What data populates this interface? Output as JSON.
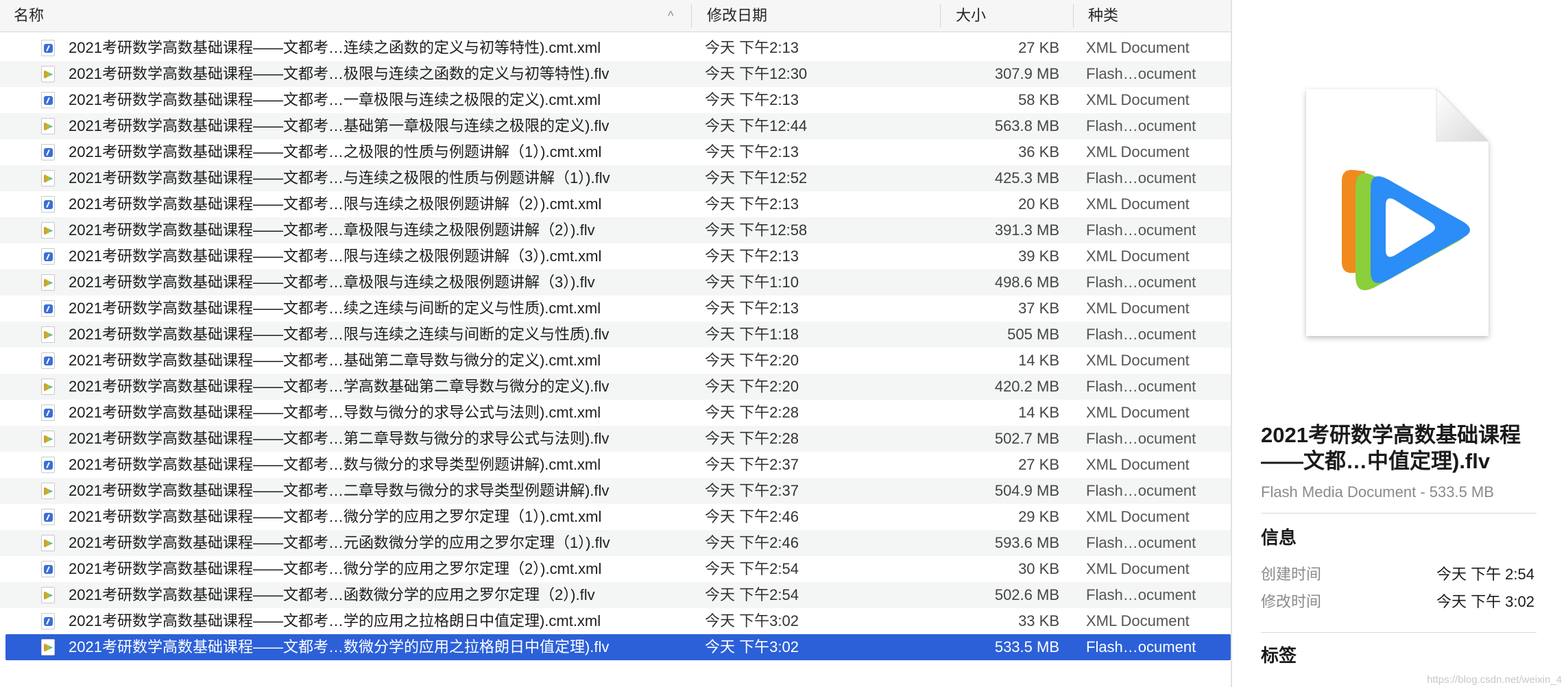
{
  "columns": {
    "name": "名称",
    "date": "修改日期",
    "size": "大小",
    "kind": "种类"
  },
  "files": [
    {
      "name": "2021考研数学高数基础课程——文都考…连续之函数的定义与初等特性).cmt.xml",
      "date": "今天 下午2:13",
      "size": "27 KB",
      "kind": "XML Document",
      "type": "xml"
    },
    {
      "name": "2021考研数学高数基础课程——文都考…极限与连续之函数的定义与初等特性).flv",
      "date": "今天 下午12:30",
      "size": "307.9 MB",
      "kind": "Flash…ocument",
      "type": "flv"
    },
    {
      "name": "2021考研数学高数基础课程——文都考…一章极限与连续之极限的定义).cmt.xml",
      "date": "今天 下午2:13",
      "size": "58 KB",
      "kind": "XML Document",
      "type": "xml"
    },
    {
      "name": "2021考研数学高数基础课程——文都考…基础第一章极限与连续之极限的定义).flv",
      "date": "今天 下午12:44",
      "size": "563.8 MB",
      "kind": "Flash…ocument",
      "type": "flv"
    },
    {
      "name": "2021考研数学高数基础课程——文都考…之极限的性质与例题讲解（1）).cmt.xml",
      "date": "今天 下午2:13",
      "size": "36 KB",
      "kind": "XML Document",
      "type": "xml"
    },
    {
      "name": "2021考研数学高数基础课程——文都考…与连续之极限的性质与例题讲解（1）).flv",
      "date": "今天 下午12:52",
      "size": "425.3 MB",
      "kind": "Flash…ocument",
      "type": "flv"
    },
    {
      "name": "2021考研数学高数基础课程——文都考…限与连续之极限例题讲解（2）).cmt.xml",
      "date": "今天 下午2:13",
      "size": "20 KB",
      "kind": "XML Document",
      "type": "xml"
    },
    {
      "name": "2021考研数学高数基础课程——文都考…章极限与连续之极限例题讲解（2）).flv",
      "date": "今天 下午12:58",
      "size": "391.3 MB",
      "kind": "Flash…ocument",
      "type": "flv"
    },
    {
      "name": "2021考研数学高数基础课程——文都考…限与连续之极限例题讲解（3）).cmt.xml",
      "date": "今天 下午2:13",
      "size": "39 KB",
      "kind": "XML Document",
      "type": "xml"
    },
    {
      "name": "2021考研数学高数基础课程——文都考…章极限与连续之极限例题讲解（3）).flv",
      "date": "今天 下午1:10",
      "size": "498.6 MB",
      "kind": "Flash…ocument",
      "type": "flv"
    },
    {
      "name": "2021考研数学高数基础课程——文都考…续之连续与间断的定义与性质).cmt.xml",
      "date": "今天 下午2:13",
      "size": "37 KB",
      "kind": "XML Document",
      "type": "xml"
    },
    {
      "name": "2021考研数学高数基础课程——文都考…限与连续之连续与间断的定义与性质).flv",
      "date": "今天 下午1:18",
      "size": "505 MB",
      "kind": "Flash…ocument",
      "type": "flv"
    },
    {
      "name": "2021考研数学高数基础课程——文都考…基础第二章导数与微分的定义).cmt.xml",
      "date": "今天 下午2:20",
      "size": "14 KB",
      "kind": "XML Document",
      "type": "xml"
    },
    {
      "name": "2021考研数学高数基础课程——文都考…学高数基础第二章导数与微分的定义).flv",
      "date": "今天 下午2:20",
      "size": "420.2 MB",
      "kind": "Flash…ocument",
      "type": "flv"
    },
    {
      "name": "2021考研数学高数基础课程——文都考…导数与微分的求导公式与法则).cmt.xml",
      "date": "今天 下午2:28",
      "size": "14 KB",
      "kind": "XML Document",
      "type": "xml"
    },
    {
      "name": "2021考研数学高数基础课程——文都考…第二章导数与微分的求导公式与法则).flv",
      "date": "今天 下午2:28",
      "size": "502.7 MB",
      "kind": "Flash…ocument",
      "type": "flv"
    },
    {
      "name": "2021考研数学高数基础课程——文都考…数与微分的求导类型例题讲解).cmt.xml",
      "date": "今天 下午2:37",
      "size": "27 KB",
      "kind": "XML Document",
      "type": "xml"
    },
    {
      "name": "2021考研数学高数基础课程——文都考…二章导数与微分的求导类型例题讲解).flv",
      "date": "今天 下午2:37",
      "size": "504.9 MB",
      "kind": "Flash…ocument",
      "type": "flv"
    },
    {
      "name": "2021考研数学高数基础课程——文都考…微分学的应用之罗尔定理（1）).cmt.xml",
      "date": "今天 下午2:46",
      "size": "29 KB",
      "kind": "XML Document",
      "type": "xml"
    },
    {
      "name": "2021考研数学高数基础课程——文都考…元函数微分学的应用之罗尔定理（1）).flv",
      "date": "今天 下午2:46",
      "size": "593.6 MB",
      "kind": "Flash…ocument",
      "type": "flv"
    },
    {
      "name": "2021考研数学高数基础课程——文都考…微分学的应用之罗尔定理（2）).cmt.xml",
      "date": "今天 下午2:54",
      "size": "30 KB",
      "kind": "XML Document",
      "type": "xml"
    },
    {
      "name": "2021考研数学高数基础课程——文都考…函数微分学的应用之罗尔定理（2）).flv",
      "date": "今天 下午2:54",
      "size": "502.6 MB",
      "kind": "Flash…ocument",
      "type": "flv"
    },
    {
      "name": "2021考研数学高数基础课程——文都考…学的应用之拉格朗日中值定理).cmt.xml",
      "date": "今天 下午3:02",
      "size": "33 KB",
      "kind": "XML Document",
      "type": "xml"
    },
    {
      "name": "2021考研数学高数基础课程——文都考…数微分学的应用之拉格朗日中值定理).flv",
      "date": "今天 下午3:02",
      "size": "533.5 MB",
      "kind": "Flash…ocument",
      "type": "flv",
      "selected": true
    }
  ],
  "preview": {
    "title": "2021考研数学高数基础课程——文都…中值定理).flv",
    "subtitle": "Flash Media Document - 533.5 MB",
    "info_heading": "信息",
    "created_label": "创建时间",
    "created_value": "今天 下午 2:54",
    "modified_label": "修改时间",
    "modified_value": "今天 下午 3:02",
    "tags_heading": "标签"
  },
  "watermark": "https://blog.csdn.net/weixin_4"
}
